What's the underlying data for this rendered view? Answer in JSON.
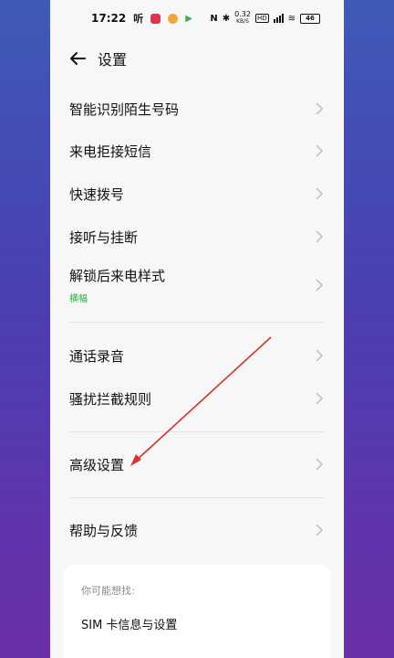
{
  "status_bar": {
    "time": "17:22",
    "app_icons": [
      {
        "name": "ting-app-icon",
        "color": "#111111"
      },
      {
        "name": "red-app-icon",
        "color": "#e8324a"
      },
      {
        "name": "weibo-app-icon",
        "color": "#f0a63a"
      },
      {
        "name": "green-app-icon",
        "color": "#3cb04a"
      }
    ],
    "speed_value": "0.32",
    "speed_unit": "KB/S",
    "battery": "46"
  },
  "header": {
    "title": "设置"
  },
  "menu": {
    "items": [
      {
        "label": "智能识别陌生号码"
      },
      {
        "label": "来电拒接短信"
      },
      {
        "label": "快速拨号"
      },
      {
        "label": "接听与挂断"
      },
      {
        "label": "解锁后来电样式",
        "sub": "横幅"
      },
      {
        "label": "通话录音"
      },
      {
        "label": "骚扰拦截规则"
      },
      {
        "label": "高级设置"
      },
      {
        "label": "帮助与反馈"
      }
    ]
  },
  "suggest": {
    "hint": "你可能想找:",
    "link": "SIM 卡信息与设置"
  },
  "colors": {
    "accent_green": "#3aa84b",
    "annotation_arrow": "#d9322c"
  }
}
